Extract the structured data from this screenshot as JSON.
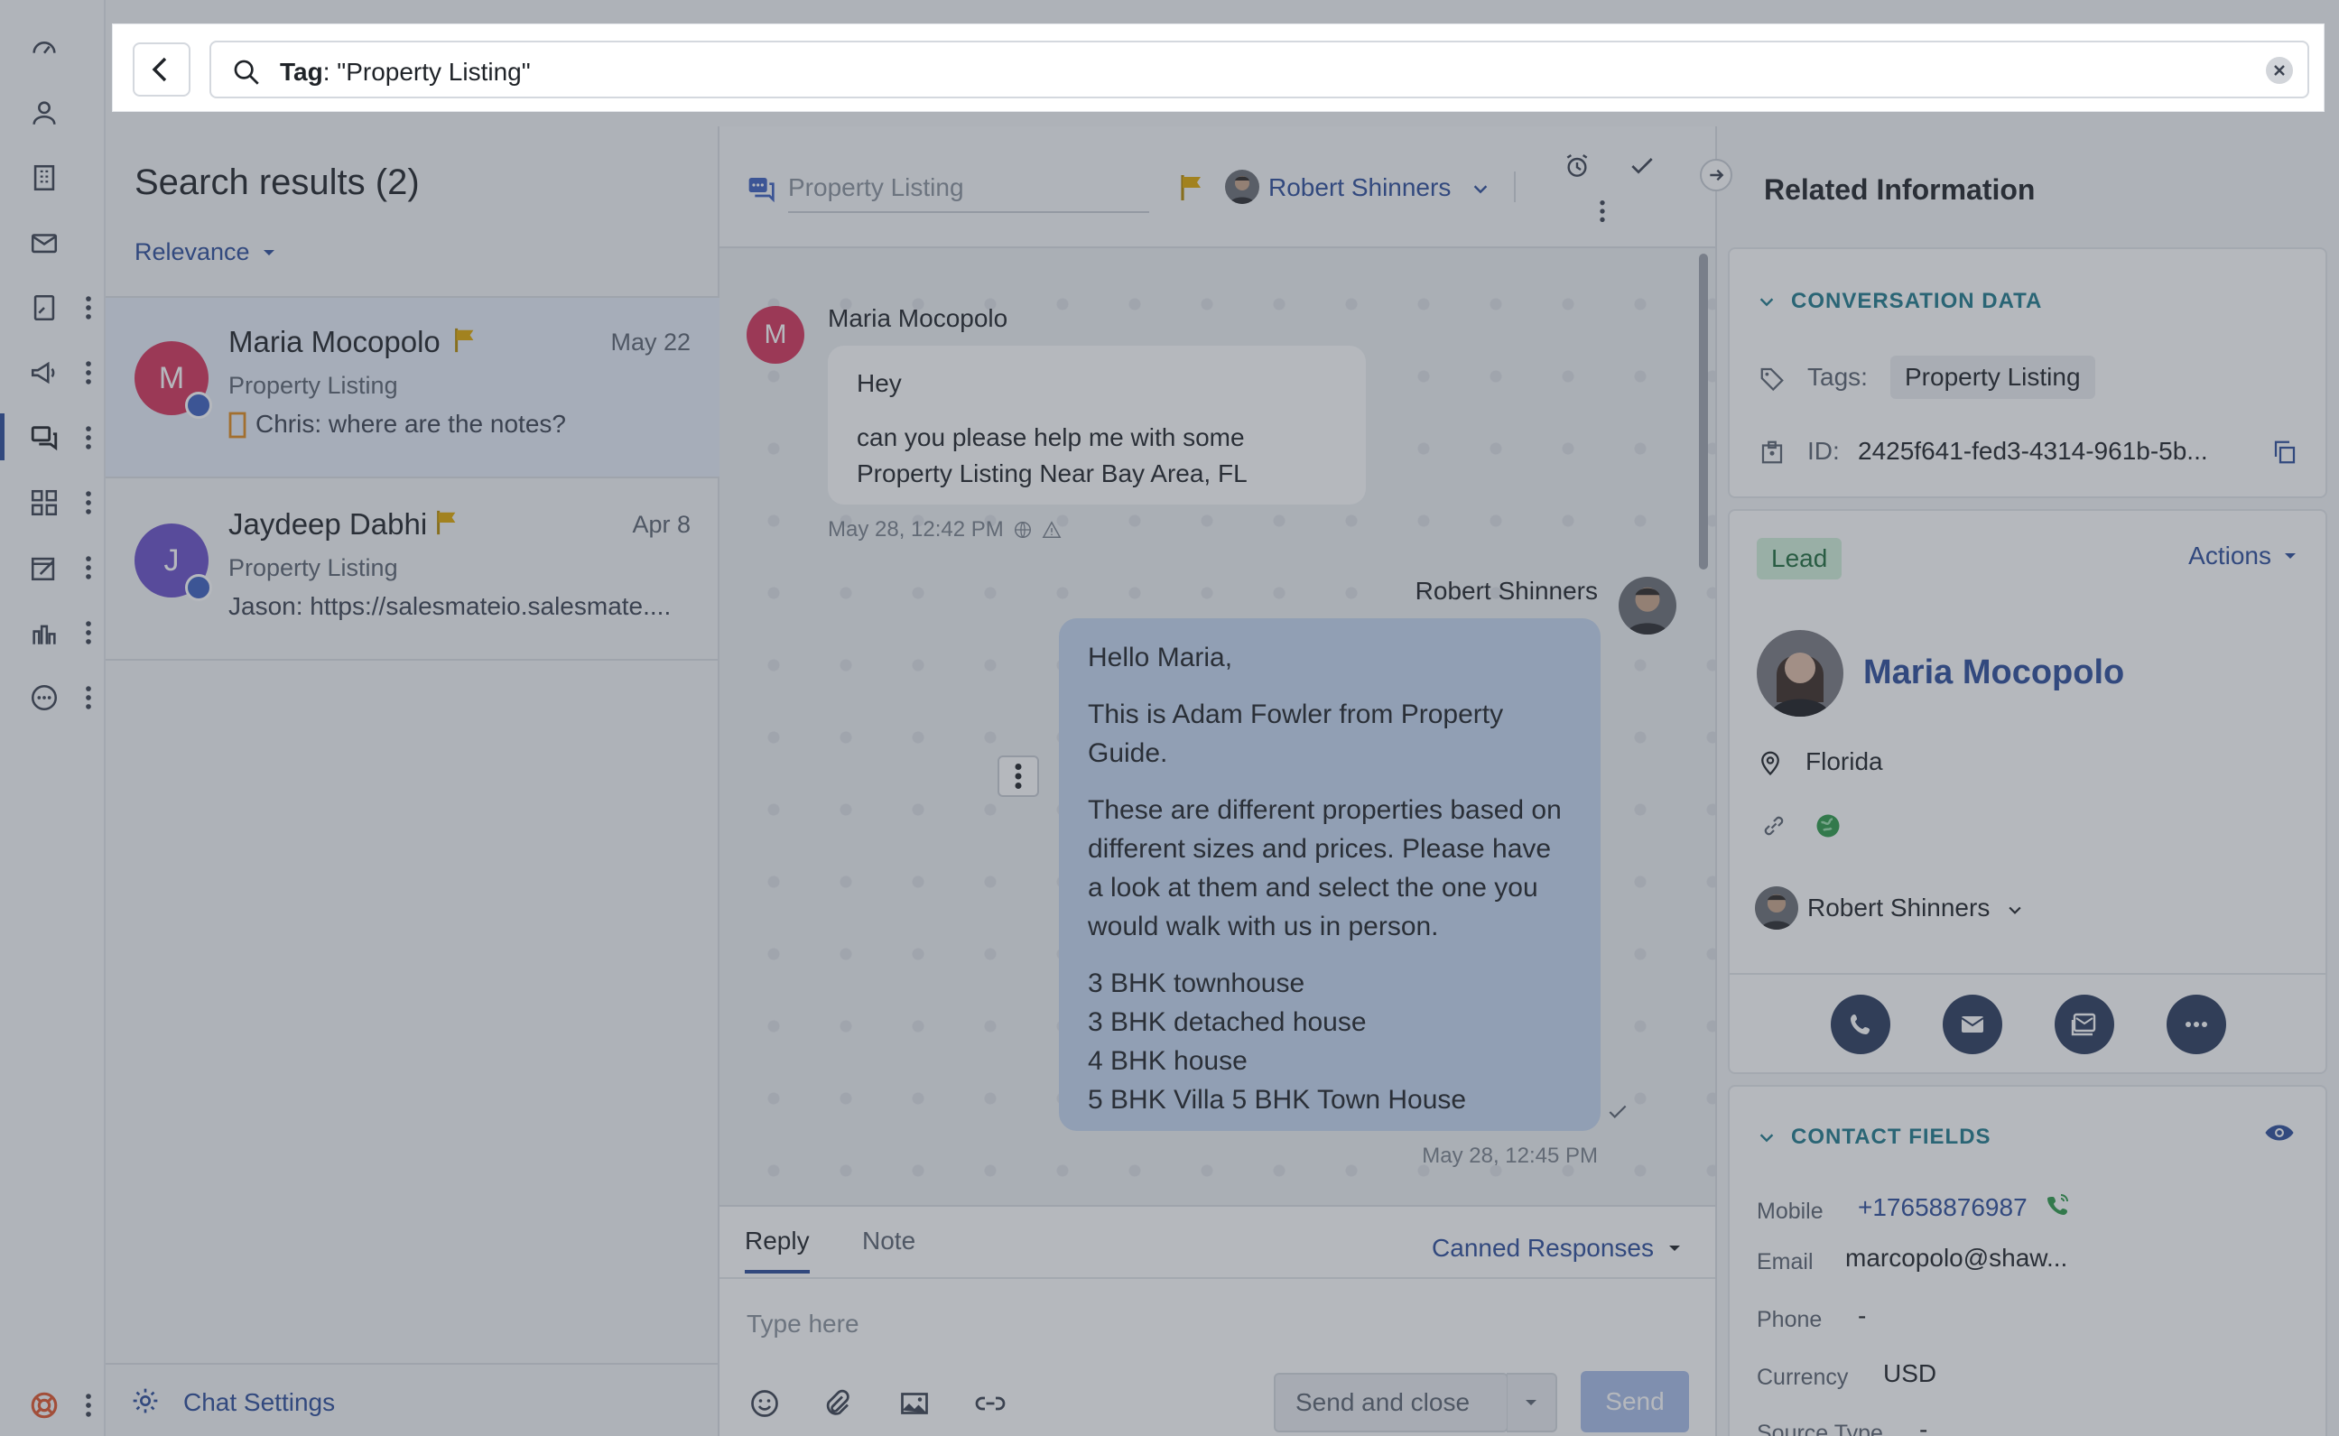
{
  "search": {
    "key": "Tag",
    "value": ": \"Property Listing\""
  },
  "results": {
    "title": "Search results (2)",
    "sort_label": "Relevance",
    "items": [
      {
        "initial": "M",
        "name": "Maria Mocopolo",
        "date": "May 22",
        "tag": "Property Listing",
        "last_message": "Chris: where are the notes?",
        "avatar_color": "#d6335a",
        "flagged": true
      },
      {
        "initial": "J",
        "name": "Jaydeep Dabhi",
        "date": "Apr 8",
        "tag": "Property Listing",
        "last_message": "Jason: https://salesmateio.salesmate....",
        "avatar_color": "#6a4fc9",
        "flagged": true
      }
    ],
    "footer_label": "Chat Settings"
  },
  "conversation": {
    "title_placeholder": "Property Listing",
    "owner": "Robert Shinners",
    "messages": [
      {
        "direction": "incoming",
        "sender": "Maria Mocopolo",
        "initial": "M",
        "lines": [
          "Hey",
          "can you please help me with some Property Listing Near Bay Area, FL"
        ],
        "time": "May 28, 12:42 PM"
      },
      {
        "direction": "outgoing",
        "sender": "Robert Shinners",
        "paragraphs": [
          "Hello Maria,",
          "This is Adam Fowler from Property Guide.",
          "These are different properties based on different sizes and prices. Please have a look at them and select the one you would walk with us in person."
        ],
        "list": [
          "3 BHK townhouse",
          "3 BHK detached house",
          "4 BHK house",
          "5 BHK Villa 5 BHK Town House"
        ],
        "time": "May 28, 12:45 PM"
      }
    ],
    "composer": {
      "tabs": [
        "Reply",
        "Note"
      ],
      "active_tab": "Reply",
      "canned_label": "Canned Responses",
      "placeholder": "Type here",
      "send_close_label": "Send and close",
      "send_label": "Send"
    }
  },
  "related": {
    "title": "Related Information",
    "conversation_data": {
      "heading": "CONVERSATION DATA",
      "tags_label": "Tags:",
      "tag_value": "Property Listing",
      "id_label": "ID:",
      "id_value": "2425f641-fed3-4314-961b-5b..."
    },
    "contact": {
      "stage": "Lead",
      "actions_label": "Actions",
      "name": "Maria Mocopolo",
      "location": "Florida",
      "owner": "Robert Shinners"
    },
    "contact_fields": {
      "heading": "CONTACT FIELDS",
      "rows": [
        {
          "label": "Mobile",
          "value": "+17658876987"
        },
        {
          "label": "Email",
          "value": "marcopolo@shaw..."
        },
        {
          "label": "Phone",
          "value": "-"
        },
        {
          "label": "Currency",
          "value": "USD"
        },
        {
          "label": "Source Type",
          "value": "-"
        }
      ]
    }
  },
  "colors": {
    "accent": "#2d4d9a",
    "section_heading": "#1f7a8c",
    "flag": "#e0a800",
    "lead_badge_bg": "#d2f0da",
    "outgoing_bubble": "#c5d7f0"
  }
}
